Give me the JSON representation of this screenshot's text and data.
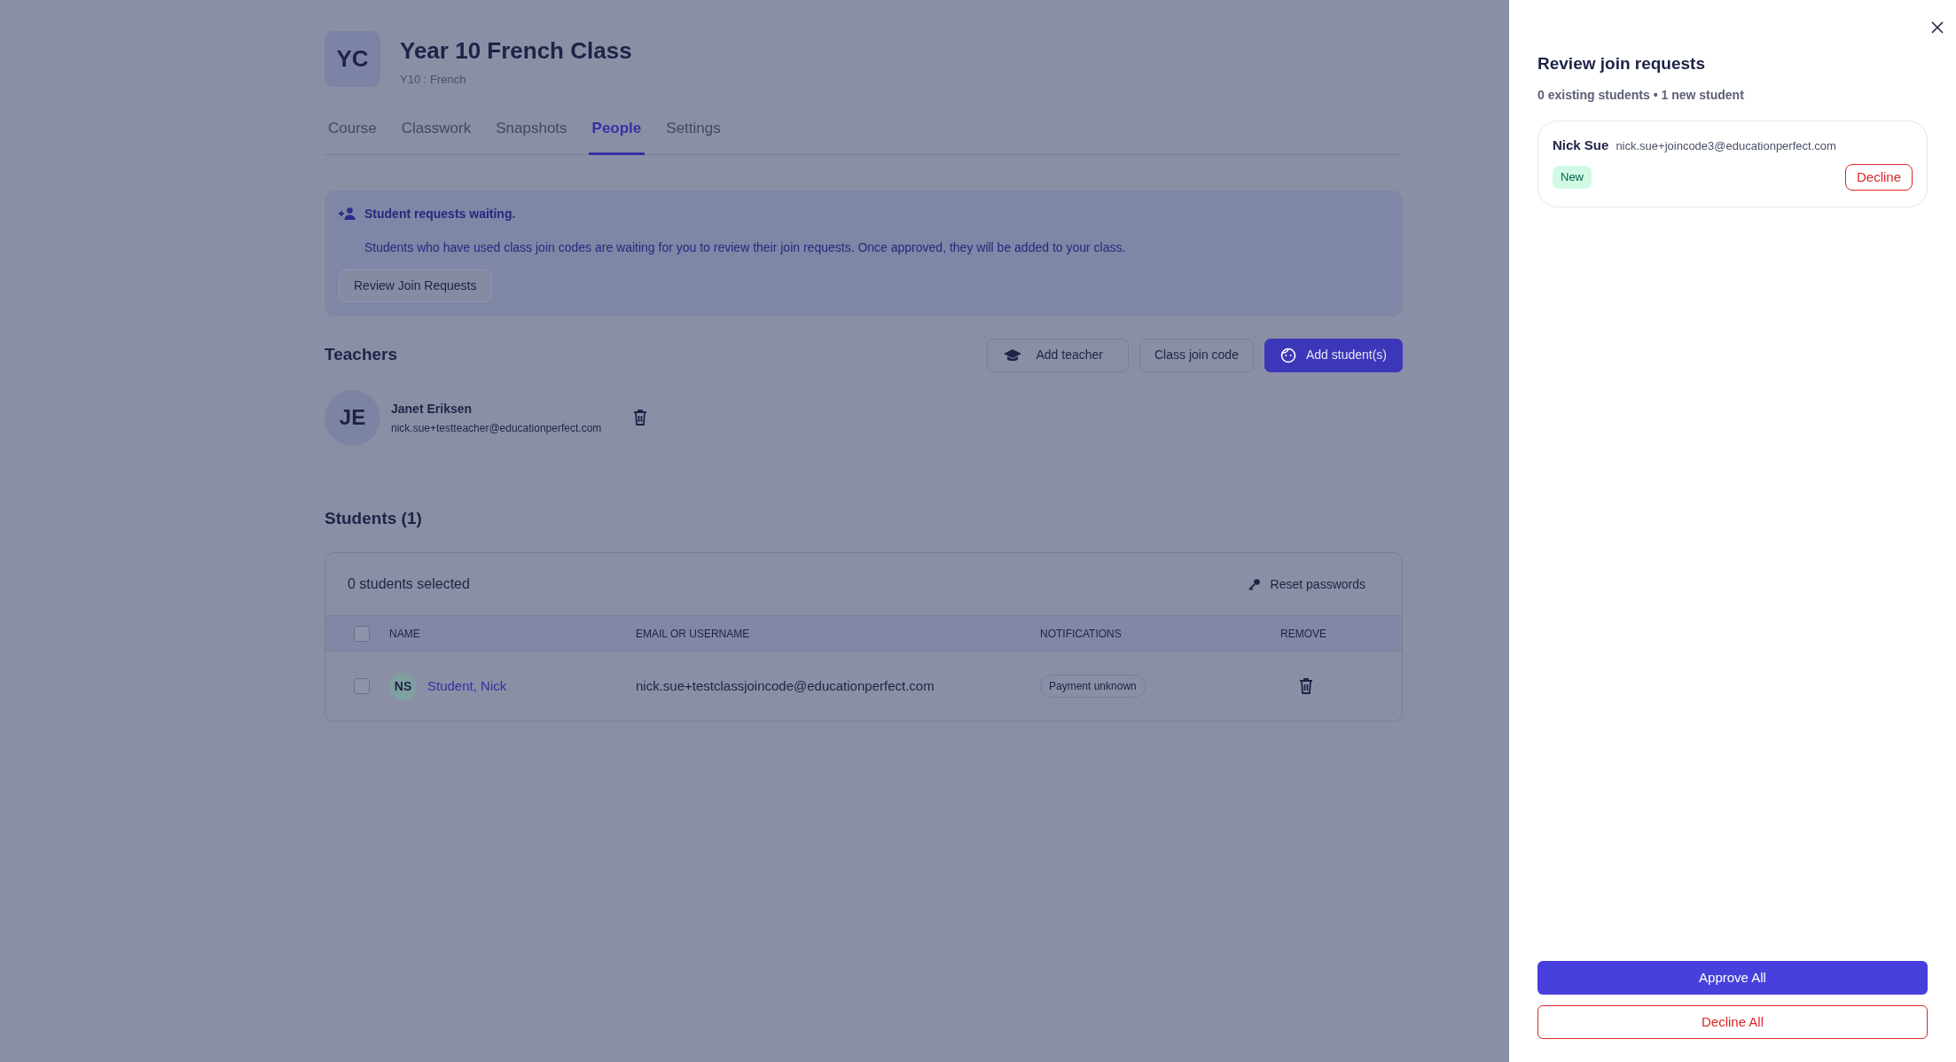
{
  "course": {
    "avatar": "YC",
    "title": "Year 10 French Class",
    "subtitle": "Y10 : French"
  },
  "tabs": [
    {
      "label": "Course",
      "selected": false
    },
    {
      "label": "Classwork",
      "selected": false
    },
    {
      "label": "Snapshots",
      "selected": false
    },
    {
      "label": "People",
      "selected": true
    },
    {
      "label": "Settings",
      "selected": false
    }
  ],
  "alert": {
    "title": "Student requests waiting.",
    "message": "Students who have used class join codes are waiting for you to review their join requests. Once approved, they will be added to your class.",
    "button": "Review Join Requests"
  },
  "teachers": {
    "heading": "Teachers",
    "actions": [
      {
        "label": "Add teacher",
        "kind": "teacher"
      },
      {
        "label": "Class join code",
        "kind": "plain"
      },
      {
        "label": "Add student(s)",
        "kind": "primary"
      }
    ],
    "people": [
      {
        "initials": "JE",
        "name": "Janet Eriksen",
        "email": "nick.sue+testteacher@educationperfect.com"
      }
    ]
  },
  "students": {
    "heading": "Students (1)",
    "selected_count": "0 students selected",
    "reset": "Reset passwords",
    "all_checked": false,
    "columns": [
      "NAME",
      "EMAIL OR USERNAME",
      "NOTIFICATIONS",
      "REMOVE"
    ],
    "rows": [
      {
        "initials": "NS",
        "name": "Student, Nick",
        "email": "nick.sue+testclassjoincode@educationperfect.com",
        "notification": "Payment unknown",
        "checked": false
      }
    ]
  },
  "panel": {
    "title": "Review join requests",
    "summary": "0 existing students • 1 new student",
    "requests": [
      {
        "name": "Nick Sue",
        "email": "nick.sue+joincode3@educationperfect.com",
        "badge": "New",
        "action": "Decline"
      }
    ],
    "approve": "Approve All",
    "decline": "Decline All"
  }
}
